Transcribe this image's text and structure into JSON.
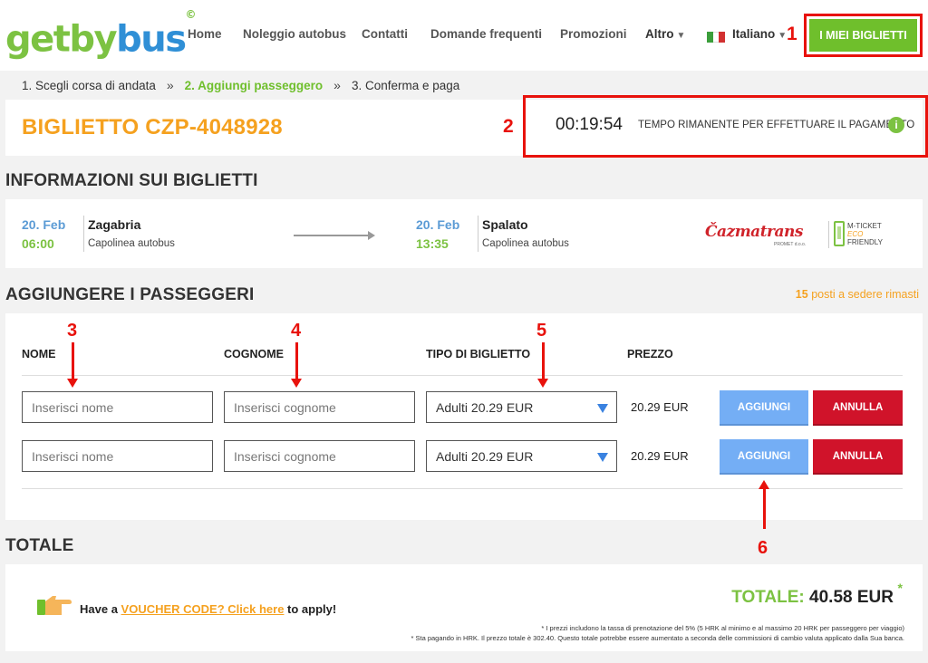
{
  "header": {
    "logo_part1": "getby",
    "logo_part2": "bus",
    "logo_mark": "©",
    "nav": [
      "Home",
      "Noleggio autobus",
      "Contatti",
      "Domande frequenti",
      "Promozioni",
      "Altro"
    ],
    "language": "Italiano",
    "my_tickets": "I MIEI BIGLIETTI"
  },
  "annotations": [
    "1",
    "2",
    "3",
    "4",
    "5",
    "6"
  ],
  "breadcrumb": {
    "step1": "1. Scegli corsa di andata",
    "step2": "2. Aggiungi passeggero",
    "step3": "3. Conferma e paga",
    "separator": "»"
  },
  "ticket": {
    "title": "BIGLIETTO CZP-4048928",
    "timer": "00:19:54",
    "timer_label": "TEMPO RIMANENTE PER EFFETTUARE IL PAGAMENTO",
    "info_symbol": "i"
  },
  "info": {
    "section_title": "INFORMAZIONI SUI BIGLIETTI",
    "departure": {
      "date": "20. Feb",
      "time": "06:00",
      "city": "Zagabria",
      "station": "Capolinea autobus"
    },
    "arrival": {
      "date": "20. Feb",
      "time": "13:35",
      "city": "Spalato",
      "station": "Capolinea autobus"
    },
    "carrier": "Čazmatrans",
    "carrier_sub": "PROMET d.o.o.",
    "mticket": [
      "M-TICKET",
      "ECO",
      "FRIENDLY"
    ]
  },
  "passengers": {
    "section_title": "AGGIUNGERE I PASSEGGERI",
    "seats_count": "15",
    "seats_label": "posti a sedere rimasti",
    "columns": {
      "name": "NOME",
      "surname": "COGNOME",
      "type": "TIPO DI BIGLIETTO",
      "price": "PREZZO"
    },
    "rows": [
      {
        "name_placeholder": "Inserisci nome",
        "surname_placeholder": "Inserisci cognome",
        "ticket_type": "Adulti 20.29 EUR",
        "price": "20.29 EUR",
        "add": "AGGIUNGI",
        "cancel": "ANNULLA"
      },
      {
        "name_placeholder": "Inserisci nome",
        "surname_placeholder": "Inserisci cognome",
        "ticket_type": "Adulti 20.29 EUR",
        "price": "20.29 EUR",
        "add": "AGGIUNGI",
        "cancel": "ANNULLA"
      }
    ]
  },
  "totals": {
    "section_title": "TOTALE",
    "voucher_prefix": "Have a",
    "voucher_link": "VOUCHER CODE? Click here",
    "voucher_suffix": "to apply!",
    "total_label": "TOTALE:",
    "total_value": "40.58 EUR",
    "asterisk": "*",
    "note1": "* I prezzi includono la tassa di prenotazione del 5% (5 HRK al minimo e al massimo 20 HRK per passeggero per viaggio)",
    "note2": "* Sta pagando in HRK. Il prezzo totale è 302.40. Questo totale potrebbe essere aumentato a seconda delle commissioni di cambio valuta applicato dalla Sua banca."
  },
  "colors": {
    "green": "#7cc242",
    "blue": "#2f8fd6",
    "orange": "#f5a11f",
    "red": "#d0132a",
    "annotation_red": "#e8120c"
  }
}
